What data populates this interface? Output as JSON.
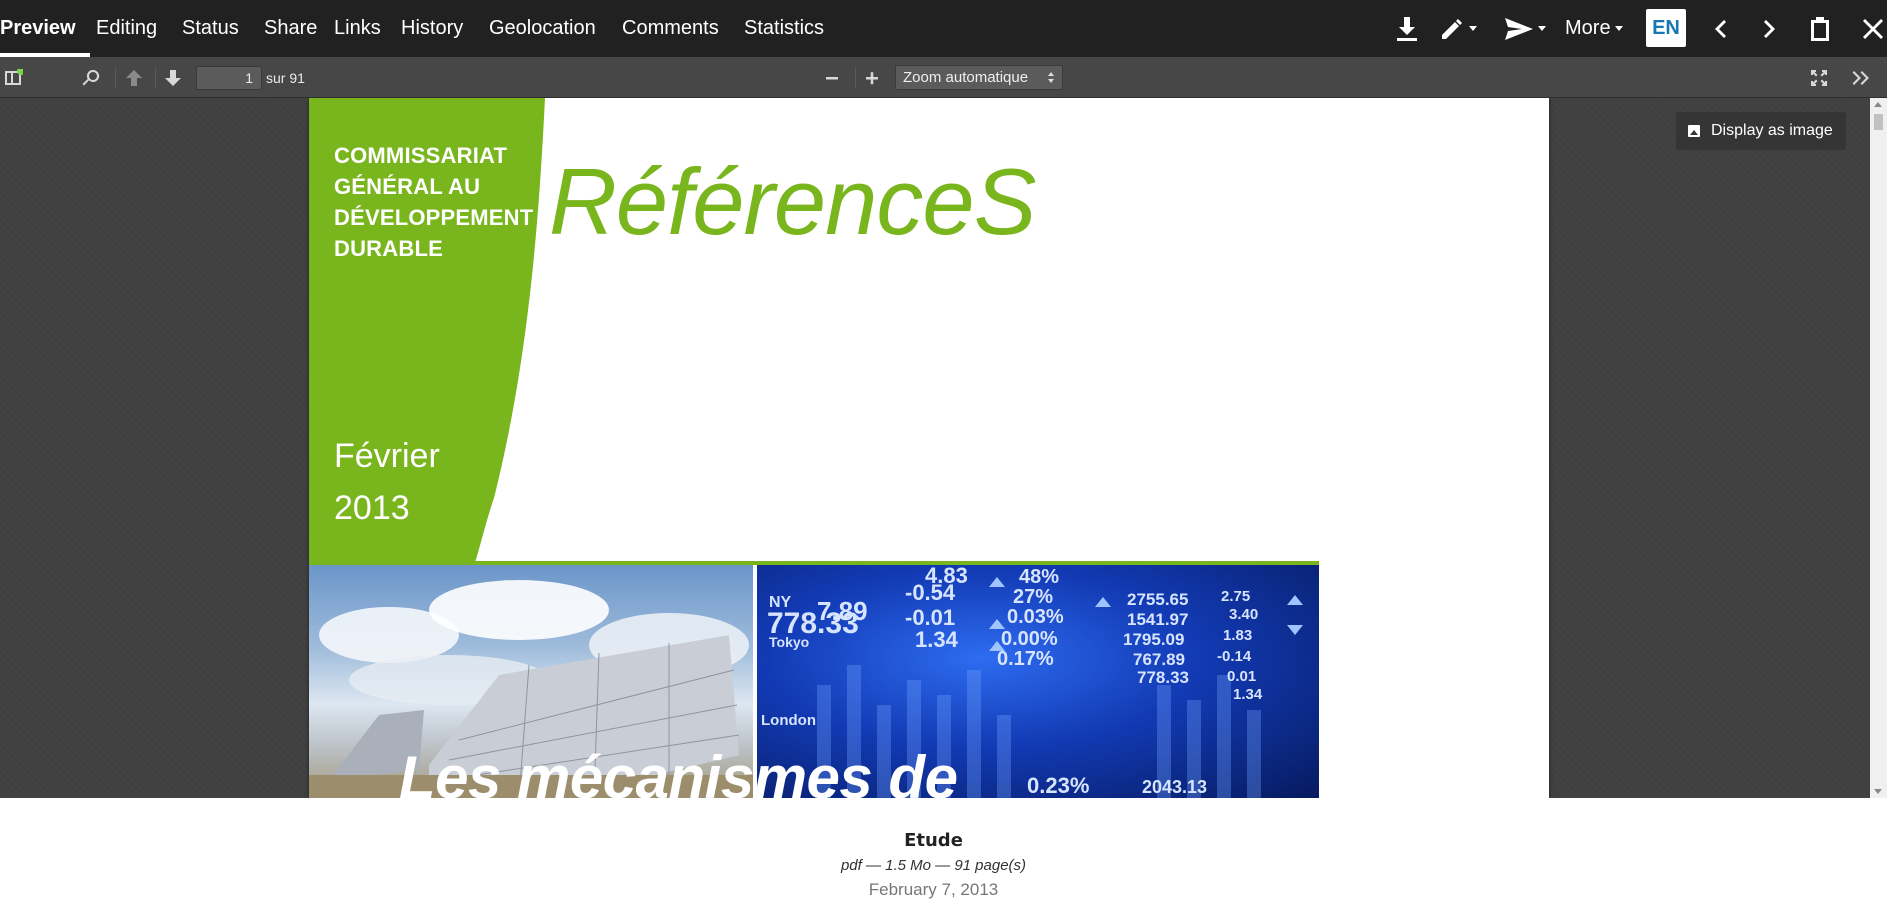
{
  "tabs": [
    {
      "label": "Preview",
      "active": true
    },
    {
      "label": "Editing"
    },
    {
      "label": "Status"
    },
    {
      "label": "Share"
    },
    {
      "label": "Links"
    },
    {
      "label": "History"
    },
    {
      "label": "Geolocation"
    },
    {
      "label": "Comments"
    },
    {
      "label": "Statistics"
    }
  ],
  "toolbar": {
    "more_label": "More",
    "lang_label": "EN",
    "icons": [
      "download-icon",
      "pencil-icon",
      "send-icon",
      "chevron-left-icon",
      "chevron-right-icon",
      "clipboard-icon",
      "close-icon"
    ]
  },
  "pdf_toolbar": {
    "page_current": "1",
    "page_total_label": "sur 91",
    "zoom_label": "Zoom automatique",
    "icons": [
      "sidebar-toggle-icon",
      "search-icon",
      "arrow-up-icon",
      "arrow-down-icon",
      "zoom-out-icon",
      "zoom-in-icon",
      "fullscreen-icon",
      "double-chevron-right-icon"
    ]
  },
  "viewer": {
    "display_as_image_label": "Display as image"
  },
  "pdf_page": {
    "org_lines": [
      "COMMISSARIAT",
      "GÉNÉRAL AU",
      "DÉVELOPPEMENT",
      "DURABLE"
    ],
    "series_title": "RéférenceS",
    "date_lines": [
      "Février",
      "2013"
    ],
    "headline": "Les mécanismes de",
    "market_numbers": [
      "4.83",
      "-0.54",
      "-0.01",
      "1.34",
      "48%",
      "27%",
      "0.03%",
      "0.00%",
      "0.17%",
      "2755.65",
      "1541.97",
      "1795.09",
      "767.89",
      "778.33",
      "2.75",
      "3.40",
      "1.83",
      "-0.14",
      "0.01",
      "1.34",
      "7.89",
      "778.33",
      "0.23%",
      "2043.13"
    ],
    "market_cities": [
      "NY",
      "Tokyo",
      "London"
    ],
    "accent_color": "#79b51c"
  },
  "document_info": {
    "type": "Etude",
    "meta": "pdf — 1.5 Mo — 91 page(s)",
    "date": "February 7, 2013"
  }
}
